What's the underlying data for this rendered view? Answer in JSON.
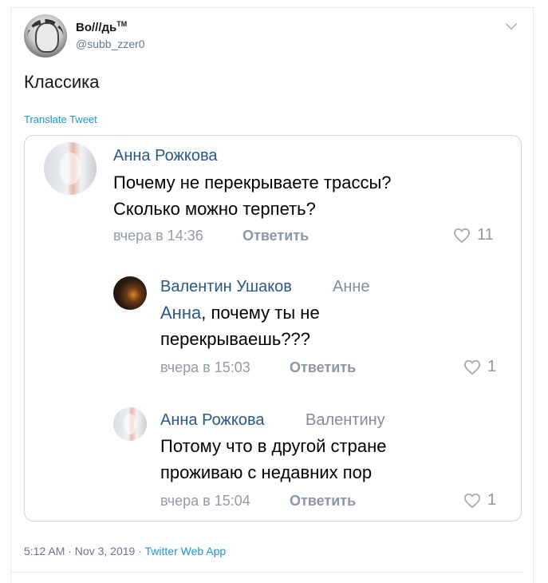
{
  "tweet": {
    "display_name": "Во///дь",
    "tm": "TM",
    "handle": "@subb_zzer0",
    "text": "Классика",
    "translate": "Translate Tweet",
    "timestamp": "5:12 AM · Nov 3, 2019 · ",
    "source": "Twitter Web App"
  },
  "comments": [
    {
      "author": "Анна Рожкова",
      "reply_to": "",
      "line1": "Почему не перекрываете трассы?",
      "line2": "Сколько можно терпеть?",
      "time": "вчера в 14:36",
      "reply_label": "Ответить",
      "likes": "11"
    },
    {
      "author": "Валентин Ушаков",
      "reply_to": "Анне",
      "mention": "Анна",
      "line1_rest": ", почему ты не",
      "line2": "перекрываешь???",
      "time": "вчера в 15:03",
      "reply_label": "Ответить",
      "likes": "1"
    },
    {
      "author": "Анна Рожкова",
      "reply_to": "Валентину",
      "line1": "Потому что в другой стране",
      "line2": "проживаю с недавних пор",
      "time": "вчера в 15:04",
      "reply_label": "Ответить",
      "likes": "1"
    }
  ],
  "colors": {
    "link_blue": "#1b95e0",
    "vk_name": "#2a5885",
    "muted": "#657786"
  }
}
